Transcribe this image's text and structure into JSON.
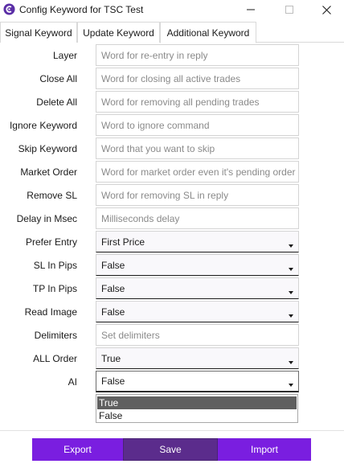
{
  "window": {
    "title": "Config Keyword for TSC Test",
    "icon": "app-logo-icon",
    "controls": {
      "minimize": "minimize-icon",
      "maximize": "maximize-icon",
      "close": "close-icon"
    }
  },
  "tabs": [
    {
      "label": "Signal Keyword",
      "active": false
    },
    {
      "label": "Update Keyword",
      "active": false
    },
    {
      "label": "Additional Keyword",
      "active": true
    }
  ],
  "rows": [
    {
      "label": "Layer",
      "type": "text",
      "value": "",
      "placeholder": "Word for re-entry in reply"
    },
    {
      "label": "Close All",
      "type": "text",
      "value": "",
      "placeholder": "Word for closing all active trades"
    },
    {
      "label": "Delete All",
      "type": "text",
      "value": "",
      "placeholder": "Word for removing all pending trades"
    },
    {
      "label": "Ignore Keyword",
      "type": "text",
      "value": "",
      "placeholder": "Word to ignore command"
    },
    {
      "label": "Skip Keyword",
      "type": "text",
      "value": "",
      "placeholder": "Word that you want to skip"
    },
    {
      "label": "Market Order",
      "type": "text",
      "value": "",
      "placeholder": "Word for market order even it's pending order"
    },
    {
      "label": "Remove SL",
      "type": "text",
      "value": "",
      "placeholder": "Word for removing SL in reply"
    },
    {
      "label": "Delay in Msec",
      "type": "text",
      "value": "",
      "placeholder": "Milliseconds delay"
    },
    {
      "label": "Prefer Entry",
      "type": "select",
      "value": "First Price"
    },
    {
      "label": "SL In Pips",
      "type": "select",
      "value": "False"
    },
    {
      "label": "TP In Pips",
      "type": "select",
      "value": "False"
    },
    {
      "label": "Read Image",
      "type": "select",
      "value": "False"
    },
    {
      "label": "Delimiters",
      "type": "text",
      "value": "",
      "placeholder": "Set delimiters"
    },
    {
      "label": "ALL Order",
      "type": "select",
      "value": "True"
    },
    {
      "label": "AI",
      "type": "select",
      "value": "False",
      "open": true
    }
  ],
  "dropdown": {
    "options": [
      "True",
      "False"
    ],
    "highlighted": "True"
  },
  "footer": {
    "export_label": "Export",
    "save_label": "Save",
    "import_label": "Import"
  },
  "colors": {
    "accent": "#7a1ee0",
    "save_button": "#5b2c8c",
    "highlight": "#5f5f5f"
  }
}
